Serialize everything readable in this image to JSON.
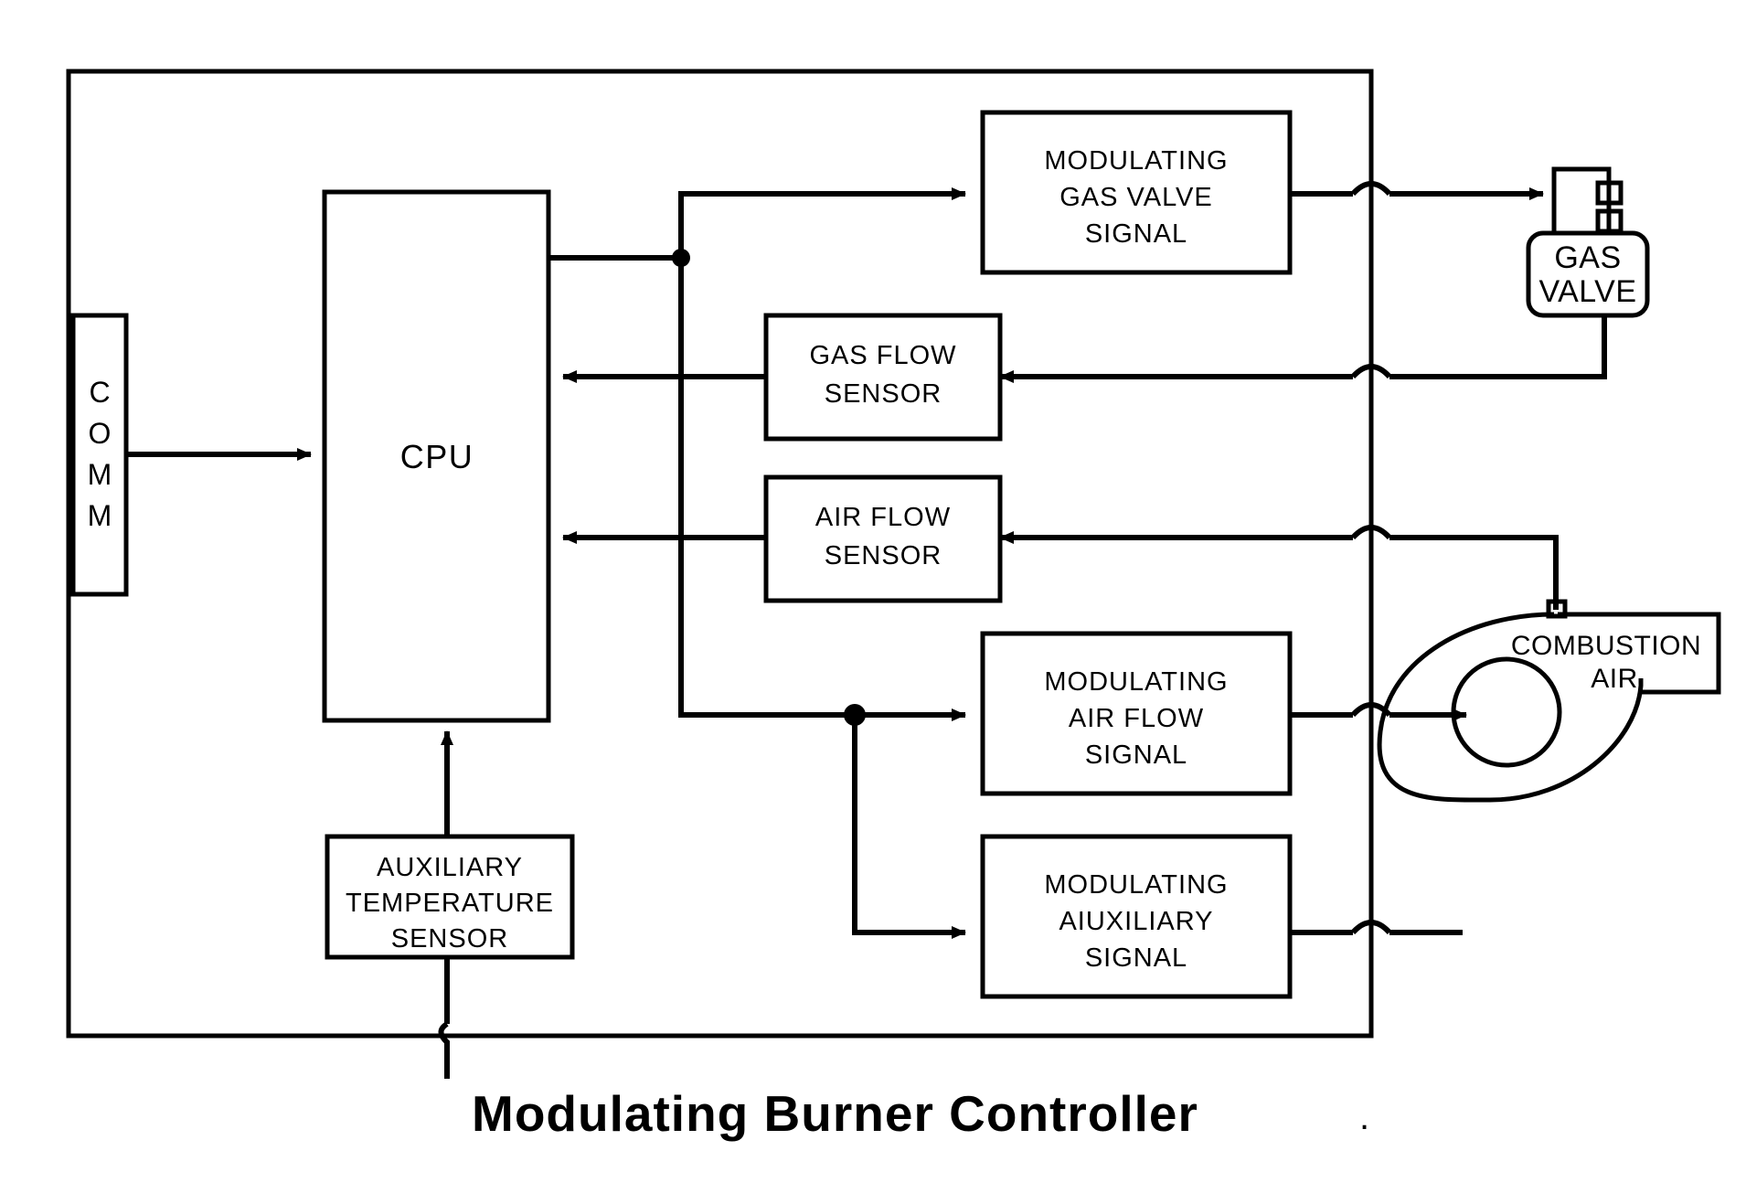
{
  "diagram": {
    "caption": "Modulating  Burner  Controller",
    "controller_boundary_name": "modulating-burner-controller-enclosure",
    "blocks": {
      "comm": {
        "label": "COMM",
        "letters": [
          "C",
          "O",
          "M",
          "M"
        ]
      },
      "cpu": {
        "label": "CPU"
      },
      "gas_valve_signal": {
        "line1": "MODULATING",
        "line2": "GAS VALVE",
        "line3": "SIGNAL"
      },
      "gas_flow_sensor": {
        "line1": "GAS FLOW",
        "line2": "SENSOR"
      },
      "air_flow_sensor": {
        "line1": "AIR FLOW",
        "line2": "SENSOR"
      },
      "air_flow_signal": {
        "line1": "MODULATING",
        "line2": "AIR FLOW",
        "line3": "SIGNAL"
      },
      "auxiliary_signal": {
        "line1": "MODULATING",
        "line2": "AIUXILIARY",
        "line3": "SIGNAL"
      },
      "auxiliary_temperature_sensor": {
        "line1": "AUXILIARY",
        "line2": "TEMPERATURE",
        "line3": "SENSOR"
      },
      "gas_valve": {
        "line1": "GAS",
        "line2": "VALVE"
      },
      "combustion_air": {
        "line1": "COMBUSTION",
        "line2": "AIR"
      }
    },
    "colors": {
      "stroke": "#000000",
      "background": "#ffffff"
    }
  }
}
